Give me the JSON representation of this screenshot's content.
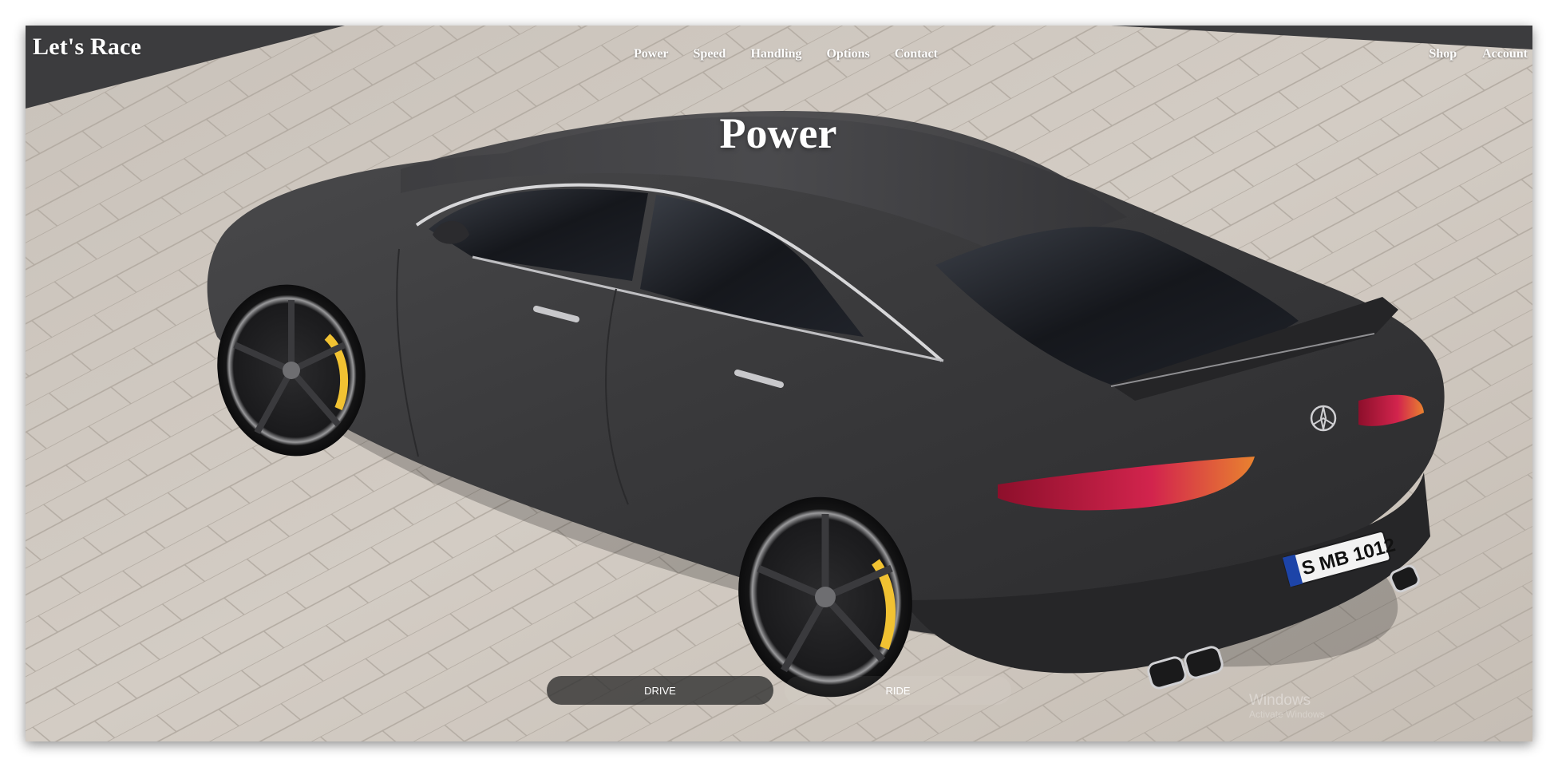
{
  "brand": {
    "title": "Let's Race"
  },
  "nav": {
    "main": [
      "Power",
      "Speed",
      "Handling",
      "Options",
      "Contact"
    ],
    "right": [
      "Shop",
      "Account"
    ]
  },
  "hero": {
    "title": "Power",
    "image_desc": "matte-grey-sports-car-on-paving",
    "plate": "S MB 1012"
  },
  "buttons": {
    "drive": "DRIVE",
    "ride": "RIDE"
  },
  "watermark": {
    "line1": "Windows",
    "line2": "Activate Windows"
  },
  "colors": {
    "text": "#ffffff",
    "active_button": "#2d2d2d",
    "car_body": "#3a3a3c",
    "pavement": "#cdc6be",
    "caliper": "#f1c232",
    "taillight": "#c0163c"
  }
}
